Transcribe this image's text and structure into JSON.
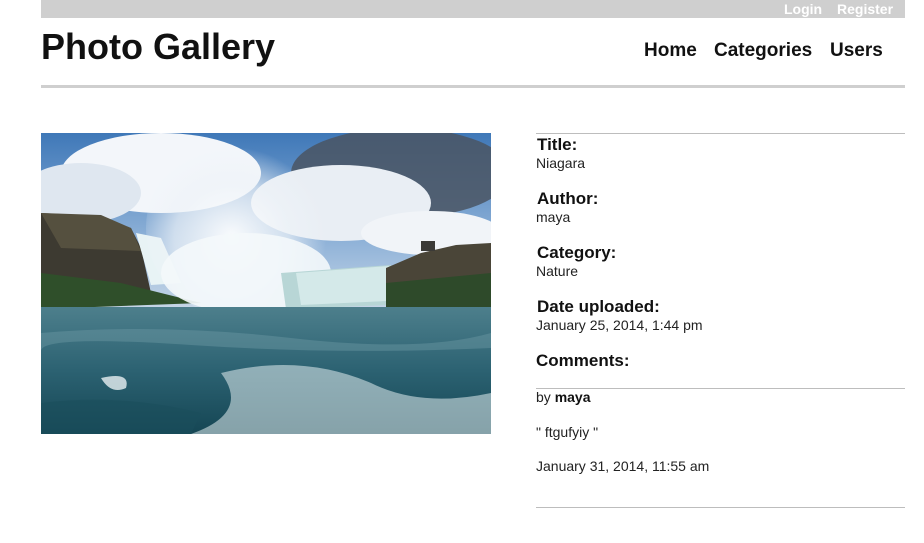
{
  "topbar": {
    "login": "Login",
    "register": "Register"
  },
  "header": {
    "title": "Photo Gallery",
    "nav": {
      "home": "Home",
      "categories": "Categories",
      "users": "Users"
    }
  },
  "photo": {
    "subject": "waterfall-photo"
  },
  "details": {
    "title_label": "Title:",
    "title_value": "Niagara",
    "author_label": "Author:",
    "author_value": "maya",
    "category_label": "Category:",
    "category_value": "Nature",
    "date_label": "Date uploaded:",
    "date_value": "January 25, 2014, 1:44 pm",
    "comments_label": "Comments:"
  },
  "comments": [
    {
      "by_prefix": "by",
      "author": "maya",
      "text": "\" ftgufyiy \"",
      "date": "January 31, 2014, 11:55 am"
    }
  ],
  "colors": {
    "topbar_bg": "#cfcfcf",
    "rule": "#bdbdbd"
  }
}
